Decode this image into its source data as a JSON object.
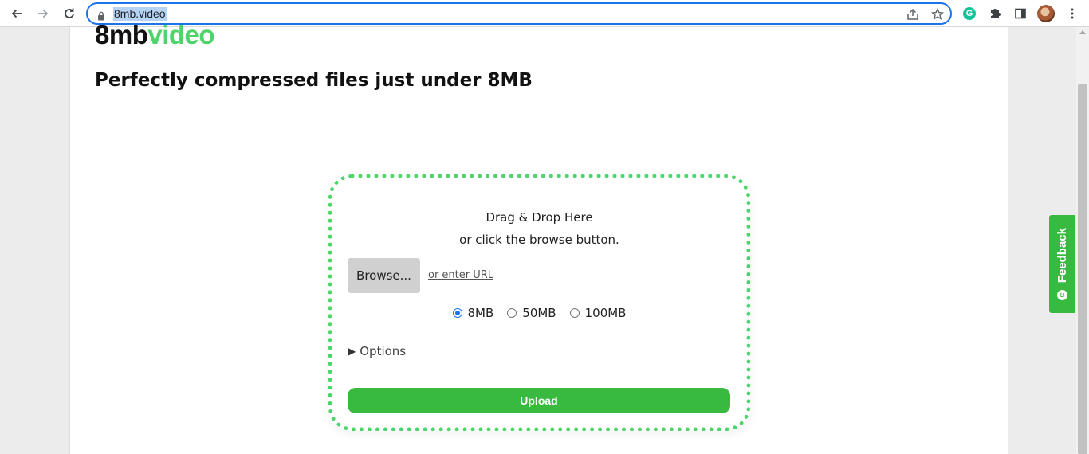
{
  "browser": {
    "url": "8mb.video",
    "icons": [
      "back-arrow-icon",
      "forward-arrow-icon",
      "reload-icon",
      "lock-icon",
      "share-icon",
      "star-icon",
      "grammarly-icon",
      "extensions-puzzle-icon",
      "side-panel-icon",
      "profile-avatar",
      "more-vert-icon"
    ],
    "grammarly_letter": "G"
  },
  "logo": {
    "part1": "8mb",
    "part2": "video"
  },
  "tagline": "Perfectly compressed files just under 8MB",
  "dropzone": {
    "line1": "Drag & Drop Here",
    "line2": "or click the browse button.",
    "browse_label": "Browse...",
    "enter_url_label": "or enter URL",
    "size_options": [
      {
        "label": "8MB",
        "selected": true
      },
      {
        "label": "50MB",
        "selected": false
      },
      {
        "label": "100MB",
        "selected": false
      }
    ],
    "options_toggle": "Options",
    "upload_label": "Upload"
  },
  "feedback_label": "Feedback",
  "colors": {
    "brand_green": "#4fd46b",
    "button_green": "#38b93f",
    "focus_blue": "#1a73e8"
  }
}
